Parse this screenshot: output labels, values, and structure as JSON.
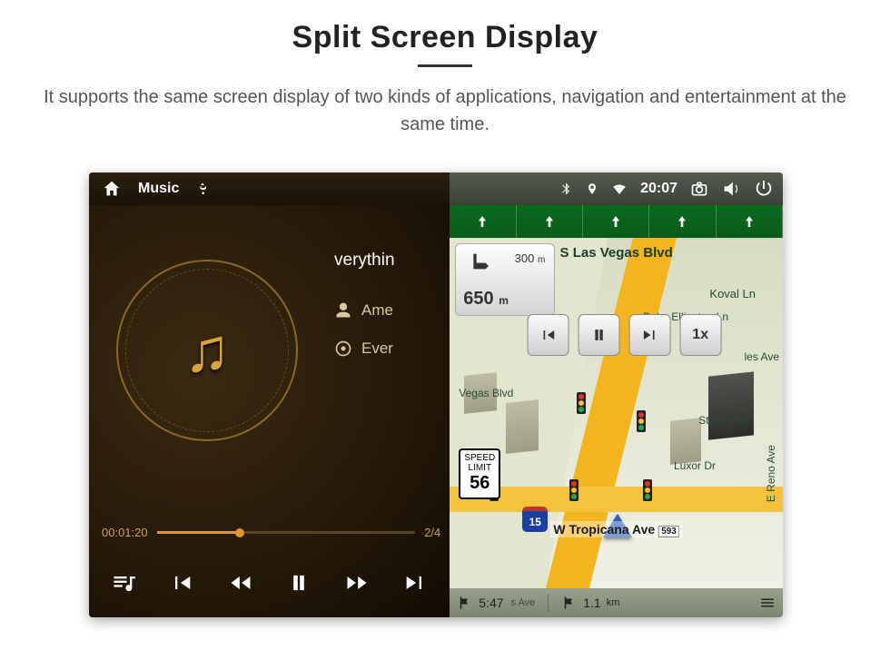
{
  "heading": "Split Screen Display",
  "subheading": "It supports the same screen display of two kinds of applications, navigation and entertainment at the same time.",
  "statusbar": {
    "app_label": "Music",
    "time": "20:07",
    "icons_left": [
      "home",
      "usb"
    ],
    "icons_right": [
      "bluetooth",
      "location",
      "wifi",
      "camera",
      "volume",
      "screen-off"
    ]
  },
  "music": {
    "now_playing_partial": "verythin",
    "rows": [
      {
        "icon": "person",
        "label": "Ame"
      },
      {
        "icon": "disc",
        "label": "Ever"
      }
    ],
    "elapsed": "00:01:20",
    "track_index": "2/4",
    "progress_percent": 32,
    "controls": [
      "playlist",
      "prev-album",
      "prev",
      "pause",
      "next",
      "next-album"
    ]
  },
  "nav": {
    "lane_arrows": [
      "up",
      "up",
      "up",
      "up",
      "up"
    ],
    "turn": {
      "distance_small": "300",
      "distance_unit": "m",
      "distance_main": "650",
      "distance_main_unit": "m"
    },
    "streets": {
      "top": "S Las Vegas Blvd",
      "koval": "Koval Ln",
      "duke": "Duke Ellington Ln",
      "vegas_blvd": "Vegas Blvd",
      "luxor": "Luxor Dr",
      "stable": "Stable Rd",
      "reno": "E Reno Ave",
      "tropicana": "W Tropicana Ave",
      "tropicana_badge": "593",
      "ali": "s Ave",
      "les": "les Ave"
    },
    "speed_sign": {
      "line1": "SPEED",
      "line2": "LIMIT",
      "value": "56"
    },
    "shield": "15",
    "sim": {
      "speed": "1x"
    },
    "footer": {
      "eta": "5:47",
      "distance": "1.1",
      "distance_unit": "km"
    }
  }
}
